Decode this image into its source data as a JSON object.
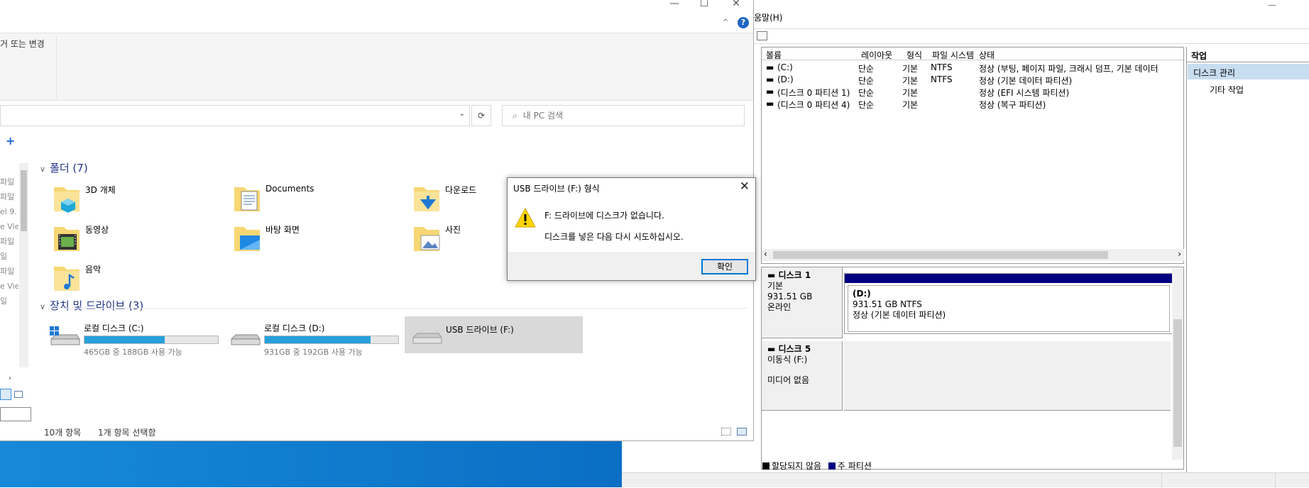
{
  "explorer": {
    "ribbon_label": "거 또는 변경",
    "search_placeholder": "내 PC 검색",
    "folders_header": "폴더 (7)",
    "folders": [
      {
        "label": "3D 개체"
      },
      {
        "label": "Documents"
      },
      {
        "label": "다운로드"
      },
      {
        "label": "동영상"
      },
      {
        "label": "바탕 화면"
      },
      {
        "label": "사진"
      },
      {
        "label": "음악"
      }
    ],
    "devices_header": "장치 및 드라이브 (3)",
    "drives": [
      {
        "label": "로컬 디스크 (C:)",
        "free": "465GB 중 188GB 사용 가능",
        "used_fraction": 0.6
      },
      {
        "label": "로컬 디스크 (D:)",
        "free": "931GB 중 192GB 사용 가능",
        "used_fraction": 0.79
      },
      {
        "label": "USB 드라이브 (F:)"
      }
    ],
    "nav_items": [
      "파일",
      "파일",
      "el 9.",
      "e Vie",
      "파일",
      "일",
      "파일",
      "e Vie",
      "일"
    ],
    "status_count": "10개 항목",
    "status_selected": "1개 항목 선택함"
  },
  "dialog": {
    "title": "USB 드라이브 (F:) 형식",
    "message1": "F: 드라이브에 디스크가 없습니다.",
    "message2": "디스크를 넣은 다음 다시 시도하십시오.",
    "ok_label": "확인"
  },
  "diskmgmt": {
    "menu_help": "움말(H)",
    "columns": [
      "볼륨",
      "레이아웃",
      "형식",
      "파일 시스템",
      "상태"
    ],
    "volumes": [
      {
        "name": "(C:)",
        "layout": "단순",
        "type": "기본",
        "fs": "NTFS",
        "status": "정상 (부팅, 페이지 파일, 크래시 덤프, 기본 데이터"
      },
      {
        "name": "(D:)",
        "layout": "단순",
        "type": "기본",
        "fs": "NTFS",
        "status": "정상 (기본 데이터 파티션)"
      },
      {
        "name": "(디스크 0 파티션 1)",
        "layout": "단순",
        "type": "기본",
        "fs": "",
        "status": "정상 (EFI 시스템 파티션)"
      },
      {
        "name": "(디스크 0 파티션 4)",
        "layout": "단순",
        "type": "기본",
        "fs": "",
        "status": "정상 (복구 파티션)"
      }
    ],
    "actions_header": "작업",
    "actions_selected": "디스크 관리",
    "actions_sub": "기타 작업",
    "disk1": {
      "name": "디스크 1",
      "type": "기본",
      "size": "931.51 GB",
      "state": "온라인",
      "part_name": "(D:)",
      "part_size": "931.51 GB NTFS",
      "part_status": "정상 (기본 데이터 파티션)"
    },
    "disk5": {
      "name": "디스크 5",
      "type": "이동식 (F:)",
      "media": "미디어 없음"
    },
    "legend_unallocated": "할당되지 않음",
    "legend_primary": "주 파티션",
    "colors": {
      "primary": "#000080",
      "unallocated": "#000000"
    }
  }
}
